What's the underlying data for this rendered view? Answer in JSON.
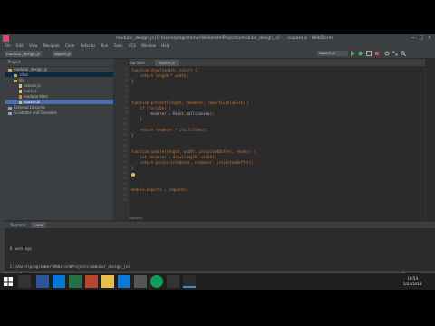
{
  "window": {
    "title": "modular_design_js [C:\\Users\\programmer\\WebstormProjects\\modular_design_js] - ...\\square.js - WebStorm",
    "min_label": "—",
    "max_label": "□",
    "close_label": "✕"
  },
  "menu": [
    "File",
    "Edit",
    "View",
    "Navigate",
    "Code",
    "Refactor",
    "Run",
    "Tools",
    "VCS",
    "Window",
    "Help"
  ],
  "toolbar": {
    "crumbs": [
      "modular_design_js",
      "square.js"
    ],
    "run_config": "square.js"
  },
  "project_panel": {
    "title": "Project",
    "items": [
      {
        "label": "modular_design_js",
        "kind": "folder"
      },
      {
        "label": ".idea",
        "kind": "folder"
      },
      {
        "label": "lib",
        "kind": "folder"
      },
      {
        "label": "canvas.js",
        "kind": "file"
      },
      {
        "label": "main.js",
        "kind": "file"
      },
      {
        "label": "modular.html",
        "kind": "file"
      },
      {
        "label": "square.js",
        "kind": "file"
      },
      {
        "label": "External Libraries",
        "kind": "folder"
      },
      {
        "label": "Scratches and Consoles",
        "kind": "folder"
      }
    ]
  },
  "editor": {
    "tabs": [
      "modular.html",
      "square.js"
    ],
    "line_numbers": [
      "1",
      "2",
      "3",
      "4",
      "5",
      "6",
      "7",
      "8",
      "9",
      "10",
      "11",
      "12",
      "13",
      "14",
      "15",
      "16",
      "17",
      "18",
      "19",
      "20",
      "21",
      "22",
      "23",
      "24",
      "25"
    ],
    "lines": [
      "function draw(length, color) {",
      "    return length * width;",
      "}",
      "",
      "",
      "",
      "function project(length, renderer, reportListToExit) {",
      "    if (forceDo) {",
      "        renderer = Paint.call(canvas);",
      "    }",
      "",
      "    return renderer * ctx.fillRect;",
      "}",
      "",
      "",
      "function update(length, width, projectedBuffer, render) {",
      "    let renderer = draw(length, width);",
      "    return project(renderer, renderer, projectedBuffer);",
      "}",
      "",
      "",
      "",
      "module.exports = {square};",
      "",
      ""
    ],
    "footer_label": "square()"
  },
  "terminal": {
    "tabs": [
      "Terminal",
      "Local"
    ],
    "lines": [
      "",
      "",
      "",
      "",
      "8 warnings",
      "",
      "",
      "",
      "C:\\Users\\programmer\\WebstormProjects\\modular_design_js>"
    ]
  },
  "statusbar": {
    "tool_tabs": [
      "TODO",
      "Terminal",
      "Event Log"
    ],
    "message": "Unregistered VCS root detected",
    "position": "25:1",
    "encoding": "UTF-8",
    "line_sep": "CRLF"
  },
  "taskbar": {
    "time": "10:54",
    "date": "5/24/2018"
  },
  "colors": {
    "ide_bg": "#2b2b2b",
    "panel_bg": "#3c3f41",
    "selection": "#4b6eaf",
    "keyword": "#cc7832",
    "function": "#ffc66d"
  }
}
